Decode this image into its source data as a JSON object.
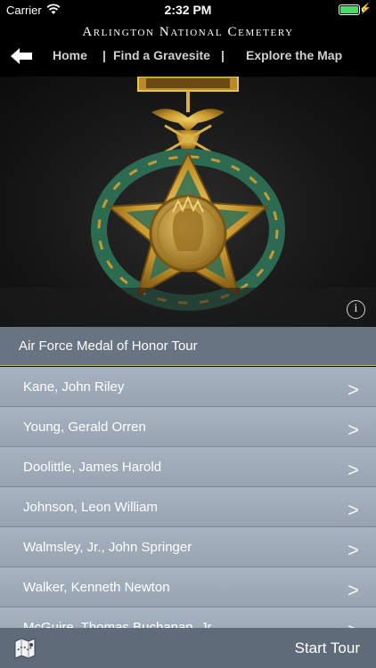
{
  "status": {
    "carrier": "Carrier",
    "time": "2:32 PM"
  },
  "header": {
    "app_title": "Arlington National Cemetery",
    "nav": {
      "home": "Home",
      "sep1": "|",
      "find": "Find a Gravesite",
      "sep2": "|",
      "explore": "Explore the Map"
    }
  },
  "hero": {
    "info_icon": "i"
  },
  "tour": {
    "title": "Air Force Medal of Honor Tour",
    "items": [
      {
        "name": "Kane, John Riley",
        "chevron": ">"
      },
      {
        "name": "Young, Gerald Orren",
        "chevron": ">"
      },
      {
        "name": "Doolittle, James Harold",
        "chevron": ">"
      },
      {
        "name": "Johnson, Leon William",
        "chevron": ">"
      },
      {
        "name": "Walmsley, Jr., John Springer",
        "chevron": ">"
      },
      {
        "name": "Walker, Kenneth Newton",
        "chevron": ">"
      },
      {
        "name": "McGuire, Thomas Buchanan, Jr.",
        "chevron": ">"
      }
    ]
  },
  "footer": {
    "start_label": "Start Tour"
  },
  "colors": {
    "accent_gold": "#c8b24a",
    "title_bar": "#687481",
    "footer_bar": "#5f6b78",
    "list_row": "#a0acba"
  }
}
